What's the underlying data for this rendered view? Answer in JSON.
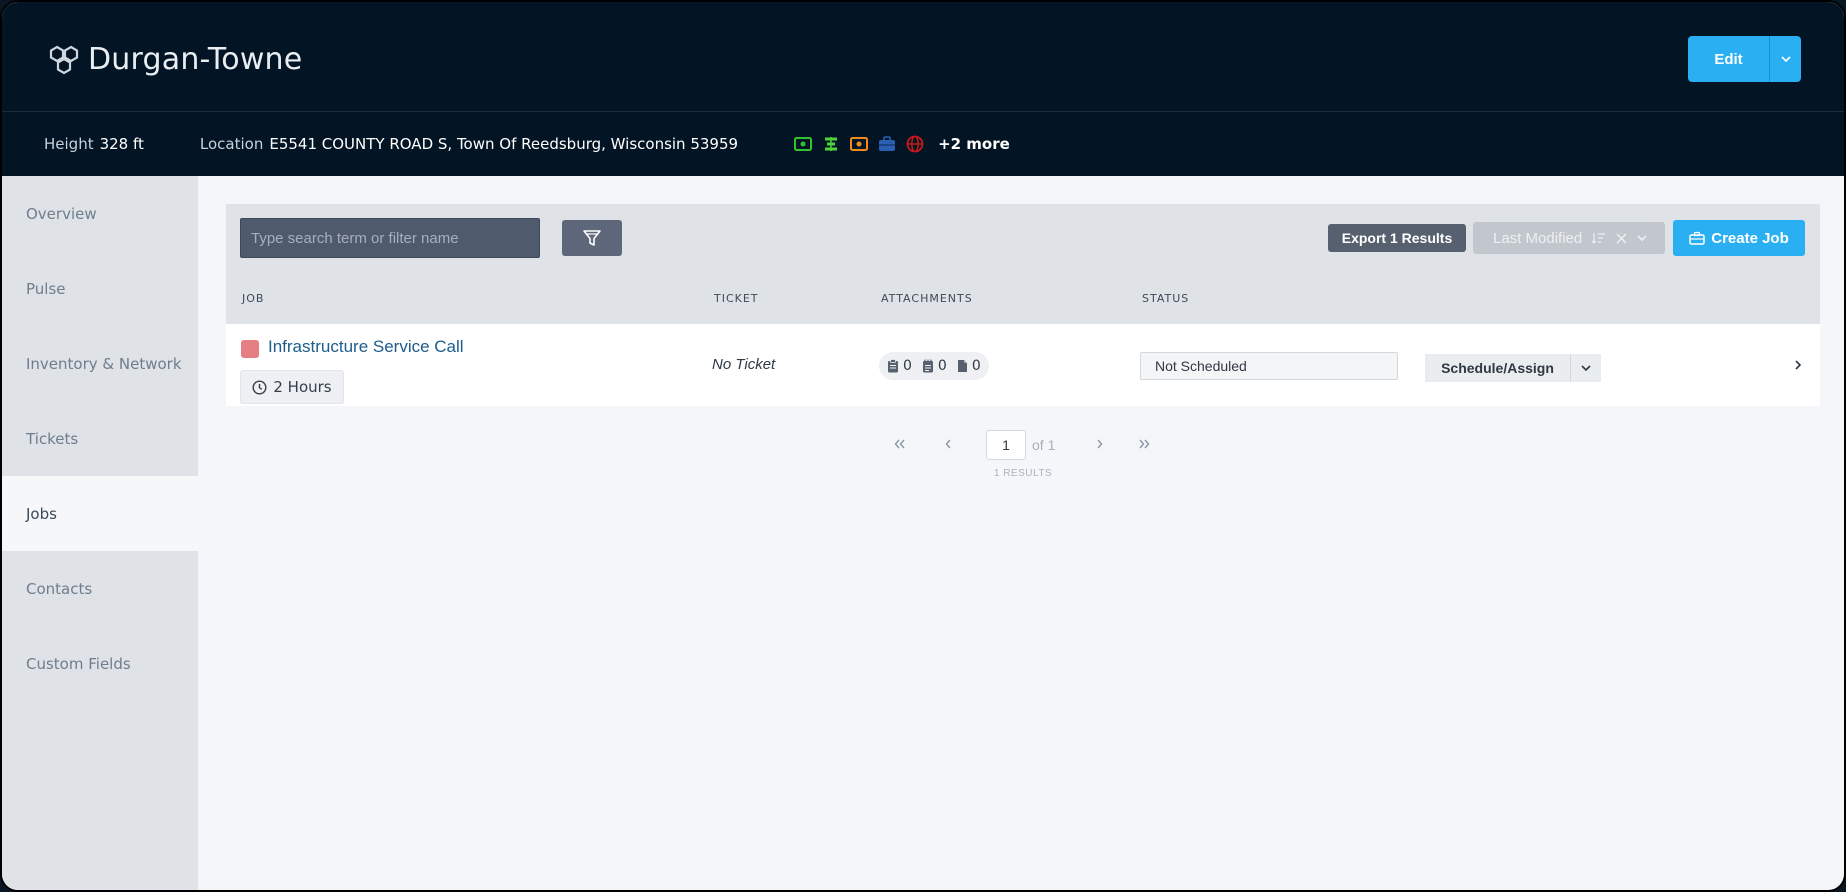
{
  "header": {
    "title": "Durgan-Towne",
    "edit_label": "Edit"
  },
  "subbar": {
    "height_label": "Height",
    "height_value": "328 ft",
    "location_label": "Location",
    "location_value": "E5541 COUNTY ROAD S, Town Of Reedsburg, Wisconsin 53959",
    "tags": [
      {
        "icon": "money-icon",
        "color": "#2fc42f"
      },
      {
        "icon": "stack-icon",
        "color": "#4cd43a"
      },
      {
        "icon": "money-icon",
        "color": "#f08a1c"
      },
      {
        "icon": "briefcase-icon",
        "color": "#2a5fb4"
      },
      {
        "icon": "globe-icon",
        "color": "#c41a1a"
      }
    ],
    "more_label": "+2 more"
  },
  "sidebar": {
    "items": [
      {
        "label": "Overview",
        "active": false
      },
      {
        "label": "Pulse",
        "active": false
      },
      {
        "label": "Inventory & Network",
        "active": false
      },
      {
        "label": "Tickets",
        "active": false
      },
      {
        "label": "Jobs",
        "active": true
      },
      {
        "label": "Contacts",
        "active": false
      },
      {
        "label": "Custom Fields",
        "active": false
      }
    ]
  },
  "toolbar": {
    "search_placeholder": "Type search term or filter name",
    "export_label": "Export 1 Results",
    "sort_label": "Last Modified",
    "create_label": "Create Job"
  },
  "table": {
    "headers": [
      "JOB",
      "TICKET",
      "ATTACHMENTS",
      "STATUS"
    ],
    "rows": [
      {
        "job": "Infrastructure Service Call",
        "duration": "2 Hours",
        "ticket": "No Ticket",
        "attachments": [
          "0",
          "0",
          "0"
        ],
        "status": "Not Scheduled",
        "action": "Schedule/Assign"
      }
    ]
  },
  "pagination": {
    "current_page": "1",
    "of_label": "of 1",
    "results_label": "1 RESULTS"
  },
  "colors": {
    "accent": "#2ab0f2",
    "header_bg": "#031424",
    "link": "#1c5d8c",
    "swatch": "#e57f83"
  }
}
